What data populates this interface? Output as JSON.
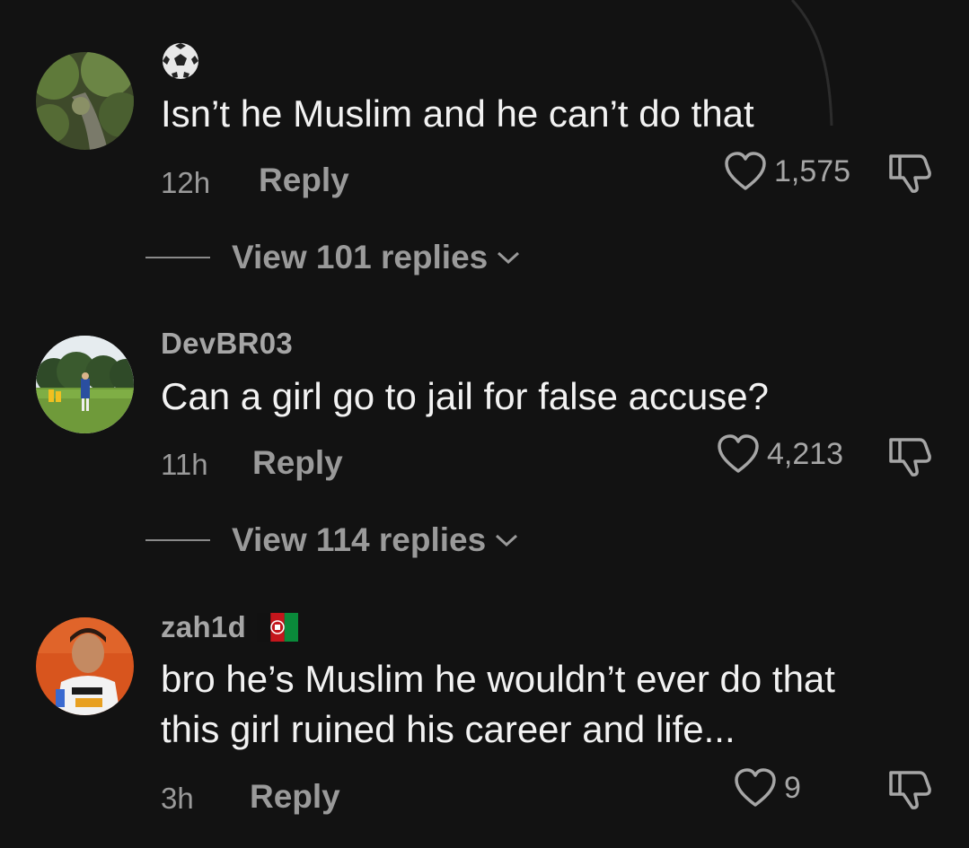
{
  "comments": [
    {
      "username": "",
      "username_icon": "soccer-ball-emoji",
      "text_lines": [
        "Isn’t he Muslim and he can’t do that"
      ],
      "time": "12h",
      "reply_label": "Reply",
      "likes": "1,575",
      "view_replies": "View 101 replies"
    },
    {
      "username": "DevBR03",
      "text_lines": [
        "Can a girl go to jail for false accuse?"
      ],
      "time": "11h",
      "reply_label": "Reply",
      "likes": "4,213",
      "view_replies": "View 114 replies"
    },
    {
      "username": "zah1d",
      "username_icon": "afghanistan-flag",
      "text_lines": [
        "bro he’s Muslim he wouldn’t ever do that",
        "this girl ruined his career and life..."
      ],
      "time": "3h",
      "reply_label": "Reply",
      "likes": "9"
    }
  ],
  "icons": {
    "like": "heart-outline-icon",
    "dislike": "thumbs-down-outline-icon",
    "expand": "chevron-down-icon"
  },
  "colors": {
    "background": "#121212",
    "primary_text": "#f2f2f2",
    "secondary_text": "#9a9a9a"
  }
}
